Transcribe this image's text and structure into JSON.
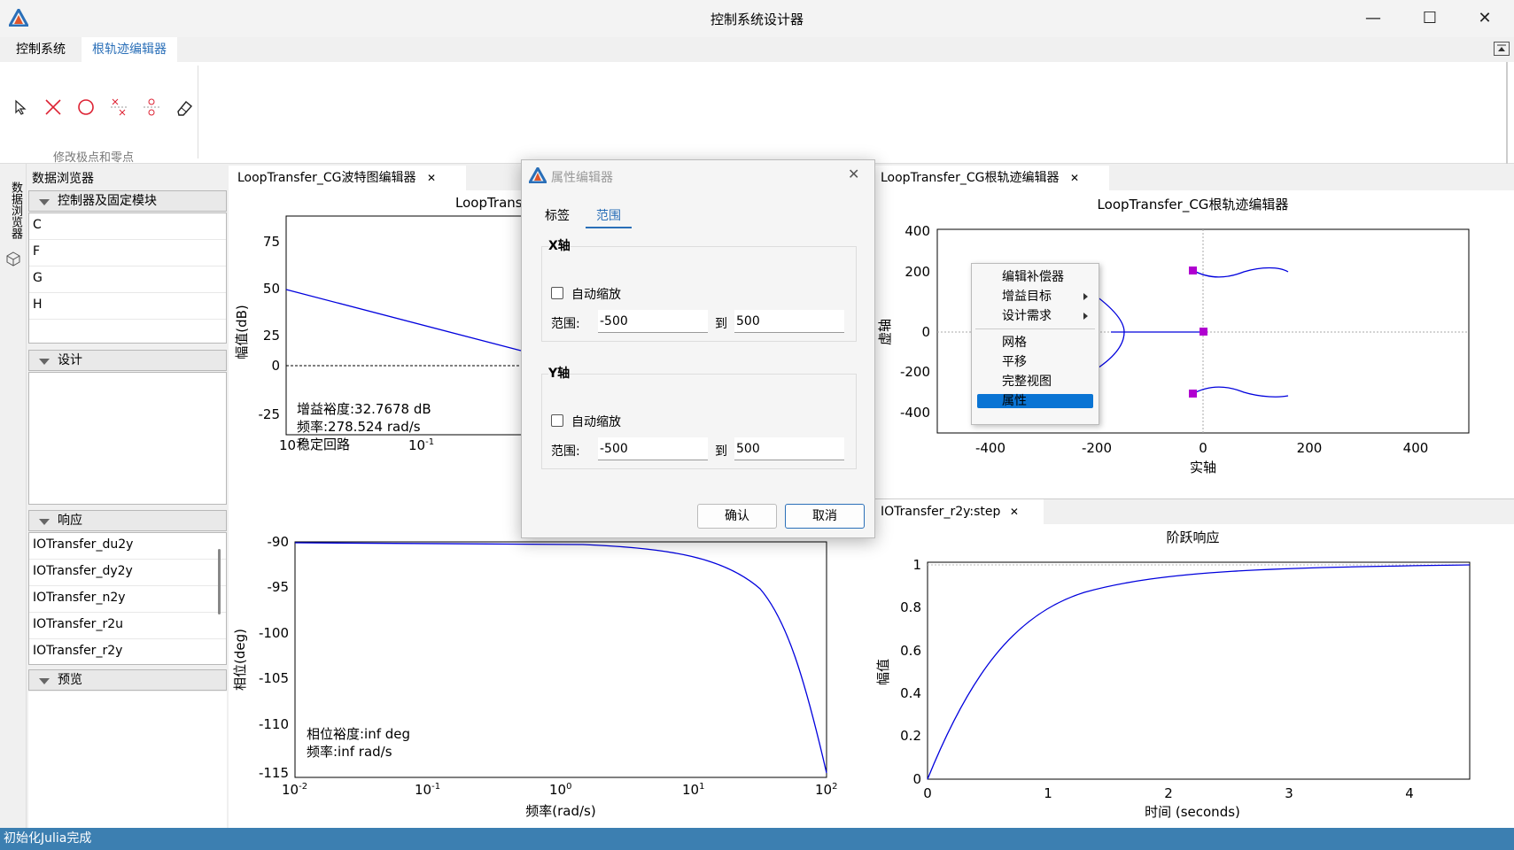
{
  "window": {
    "title": "控制系统设计器",
    "minimize": "—",
    "maximize": "☐",
    "close": "✕"
  },
  "ribbon": {
    "tabs": [
      "控制系统",
      "根轨迹编辑器"
    ],
    "active_tab": "根轨迹编辑器",
    "tools": [
      "pointer-icon",
      "add-pole-icon",
      "add-zero-icon",
      "add-complex-pole-icon",
      "add-complex-zero-icon",
      "eraser-icon"
    ],
    "group_label": "修改极点和零点"
  },
  "sidebar": {
    "vertical_label": "数据浏览器"
  },
  "browser": {
    "title": "数据浏览器",
    "sections": {
      "controllers": {
        "label": "控制器及固定模块",
        "items": [
          "C",
          "F",
          "G",
          "H"
        ]
      },
      "design": {
        "label": "设计"
      },
      "response": {
        "label": "响应",
        "items": [
          "IOTransfer_du2y",
          "IOTransfer_dy2y",
          "IOTransfer_n2y",
          "IOTransfer_r2u",
          "IOTransfer_r2y"
        ]
      },
      "preview": {
        "label": "预览"
      }
    }
  },
  "bode": {
    "tab": "LoopTransfer_CG波特图编辑器",
    "title": "LoopTrans",
    "mag": {
      "ylabel": "幅值(dB)",
      "yticks": [
        "75",
        "50",
        "25",
        "0",
        "-25"
      ],
      "xticks": [
        "10",
        "10"
      ],
      "xexp": [
        "-2",
        "-1"
      ],
      "annotation": [
        "增益裕度:32.7678 dB",
        "频率:278.524 rad/s",
        "稳定回路"
      ]
    },
    "phase": {
      "ylabel": "相位(deg)",
      "xlabel": "频率(rad/s)",
      "yticks": [
        "-90",
        "-95",
        "-100",
        "-105",
        "-110",
        "-115"
      ],
      "xticks": [
        "10",
        "10",
        "10",
        "10",
        "10"
      ],
      "xexp": [
        "-2",
        "-1",
        "0",
        "1",
        "2"
      ],
      "annotation": [
        "相位裕度:inf deg",
        "频率:inf rad/s"
      ]
    }
  },
  "rlocus": {
    "tab": "LoopTransfer_CG根轨迹编辑器",
    "title": "LoopTransfer_CG根轨迹编辑器",
    "ylabel": "虚轴",
    "xlabel": "实轴",
    "yticks": [
      "400",
      "200",
      "0",
      "-200",
      "-400"
    ],
    "xticks": [
      "-400",
      "-200",
      "0",
      "200",
      "400"
    ]
  },
  "step": {
    "tab": "IOTransfer_r2y:step",
    "title": "阶跃响应",
    "ylabel": "幅值",
    "xlabel": "时间 (seconds)",
    "yticks": [
      "1",
      "0.8",
      "0.6",
      "0.4",
      "0.2",
      "0"
    ],
    "xticks": [
      "0",
      "1",
      "2",
      "3",
      "4"
    ]
  },
  "context_menu": {
    "items": [
      "编辑补偿器",
      "增益目标",
      "设计需求",
      "网格",
      "平移",
      "完整视图",
      "属性"
    ],
    "selected": "属性"
  },
  "dialog": {
    "title": "属性编辑器",
    "tabs": [
      "标签",
      "范围"
    ],
    "active_tab": "范围",
    "x_axis": {
      "title": "X轴",
      "auto_label": "自动缩放",
      "auto": false,
      "range_label": "范围:",
      "to_label": "到",
      "min": "-500",
      "max": "500"
    },
    "y_axis": {
      "title": "Y轴",
      "auto_label": "自动缩放",
      "auto": false,
      "range_label": "范围:",
      "to_label": "到",
      "min": "-500",
      "max": "500"
    },
    "ok": "确认",
    "cancel": "取消"
  },
  "status": {
    "text": "初始化Julia完成"
  },
  "colors": {
    "accent": "#2a6fb8",
    "status_bar": "#3c7fb1",
    "curve": "#0000dd",
    "marker": "#b000d0",
    "selection": "#0a74d4"
  }
}
